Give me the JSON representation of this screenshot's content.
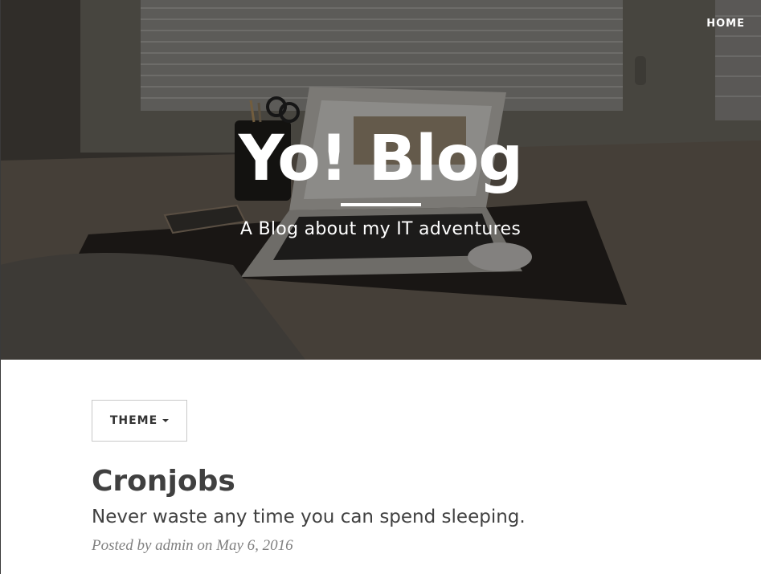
{
  "nav": {
    "home_label": "HOME"
  },
  "hero": {
    "title": "Yo! Blog",
    "subtitle": "A Blog about my IT adventures"
  },
  "theme_menu": {
    "label": "THEME",
    "icon": "caret-down-icon"
  },
  "post": {
    "title": "Cronjobs",
    "subtitle": "Never waste any time you can spend sleeping.",
    "meta_prefix": "Posted by",
    "author": "admin",
    "meta_on": "on",
    "date": "May 6, 2016"
  }
}
